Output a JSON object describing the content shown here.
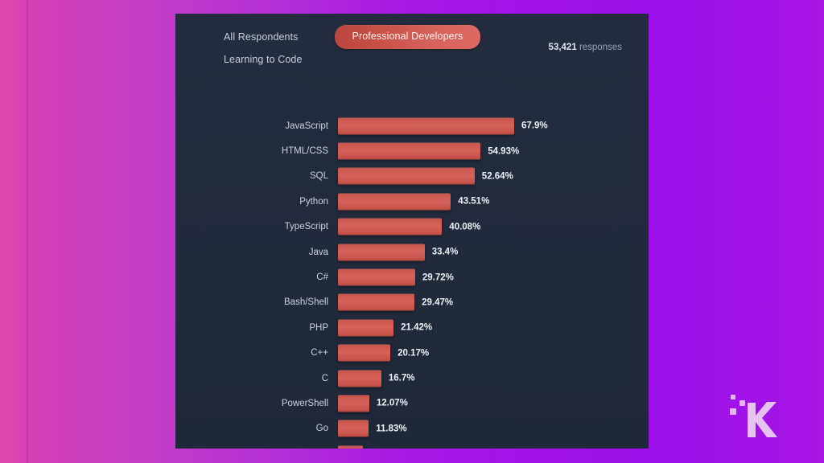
{
  "background": {
    "gradient_from": "#dd4aad",
    "gradient_to": "#a816e2"
  },
  "panel": {
    "background_color": "#222b3d"
  },
  "tabs": {
    "items": [
      {
        "label": "All Respondents",
        "active": false
      },
      {
        "label": "Professional Developers",
        "active": true
      },
      {
        "label": "Learning to Code",
        "active": false
      }
    ],
    "active_color": "#cf5b51"
  },
  "responses": {
    "count": "53,421",
    "label": "responses"
  },
  "logo": {
    "name": "knowtechie-k-logo",
    "letter": "K"
  },
  "chart_data": {
    "type": "bar",
    "orientation": "horizontal",
    "title": "",
    "xlabel": "",
    "ylabel": "",
    "grid": false,
    "legend": false,
    "axis_max": 67.9,
    "value_suffix": "%",
    "categories": [
      "JavaScript",
      "HTML/CSS",
      "SQL",
      "Python",
      "TypeScript",
      "Java",
      "C#",
      "Bash/Shell",
      "PHP",
      "C++",
      "C",
      "PowerShell",
      "Go",
      ""
    ],
    "values": [
      67.9,
      54.93,
      52.64,
      43.51,
      40.08,
      33.4,
      29.72,
      29.47,
      21.42,
      20.17,
      16.7,
      12.07,
      11.83,
      9.55
    ],
    "labels": [
      "67.9%",
      "54.93%",
      "52.64%",
      "43.51%",
      "40.08%",
      "33.4%",
      "29.72%",
      "29.47%",
      "21.42%",
      "20.17%",
      "16.7%",
      "12.07%",
      "11.83%",
      ""
    ],
    "bar_color": "#cf5b51"
  }
}
